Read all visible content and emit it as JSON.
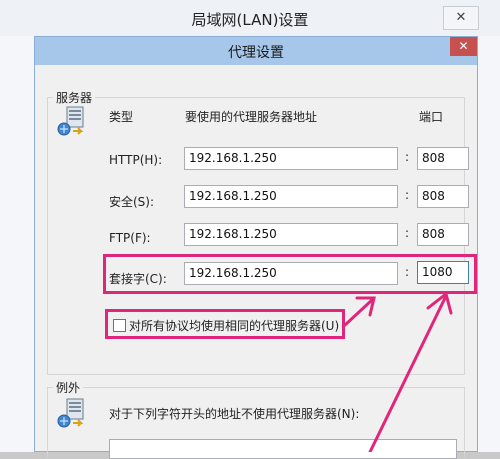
{
  "lan_window": {
    "title": "局域网(LAN)设置",
    "close_glyph": "✕"
  },
  "proxy_dialog": {
    "title": "代理设置",
    "close_glyph": "✕",
    "servers": {
      "group_label": "服务器",
      "col_type": "类型",
      "col_address": "要使用的代理服务器地址",
      "col_port": "端口",
      "rows": [
        {
          "label": "HTTP(H):",
          "address": "192.168.1.250",
          "port": "808"
        },
        {
          "label": "安全(S):",
          "address": "192.168.1.250",
          "port": "808"
        },
        {
          "label": "FTP(F):",
          "address": "192.168.1.250",
          "port": "808"
        },
        {
          "label": "套接字(C):",
          "address": "192.168.1.250",
          "port": "1080"
        }
      ],
      "same_proxy_checkbox": {
        "label": "对所有协议均使用相同的代理服务器(U)",
        "checked": false
      }
    },
    "exceptions": {
      "group_label": "例外",
      "description": "对于下列字符开头的地址不使用代理服务器(N):"
    }
  },
  "annotation": {
    "color": "#e0267a"
  }
}
